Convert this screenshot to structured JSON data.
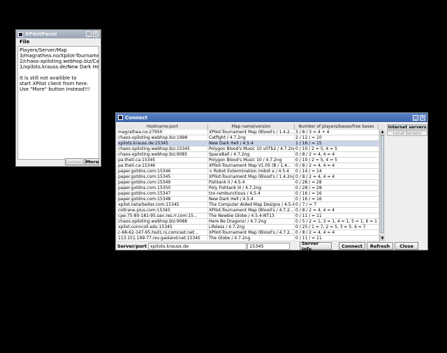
{
  "panel": {
    "title": "XPilotPanel",
    "menu_file": "File",
    "text": "Players/Server/Map\n3/magrathea.no/Xpilot-Tournament Map\n2/chaos-xpiloting.webhop.biz/Catfight\n1/xpilots.krauss.de/New Dark Hell\n\nIt is still not availible to\nstart XPilot client from here.\nUse \"More\" button instead!!!",
    "connect_label": "Connect",
    "more_label": "More"
  },
  "connect": {
    "title": "Connect",
    "headers": [
      "Hostname:port",
      "Map name/version",
      "Number of players/bases/free bases"
    ],
    "rows": [
      [
        "magrathea.no:27950",
        "XPilot-Tournament Map (Blood's / 1.4.2...",
        "3 / 8 / 3 = 4 + 4"
      ],
      [
        "chaos-xpiloting.webhop.biz:1998",
        "Catfight / 4.7.2ng",
        "2 / 12 / = 10"
      ],
      [
        "xpilots.krauss.de:15345",
        "New Dark Hell / 4.5.4",
        "1 / 16 / = 15"
      ],
      [
        "chaos-xpiloting.webhop.biz:15345",
        "Polygon Blood's Music 10 v0Tb2 / 4.7.2ng",
        "0 / 10 / 2 = 5, 4 = 5"
      ],
      [
        "chaos-xpiloting.webhop.biz:9085",
        "SpaceBall / 4.7.2ng",
        "0 / 8 / 2 = 4, 4 = 4"
      ],
      [
        "pa.theti.ca:15345",
        "Polygon Blood's Music 10 / 4.7.2ng",
        "0 / 10 / 2 = 5, 4 = 5"
      ],
      [
        "pa.theti.ca:15346",
        "XPilot-Tournament Map V1.05 (B / 1.4...",
        "0 / 8 / 2 = 4, 4 = 4"
      ],
      [
        "paper.gotdns.com:15346",
        "> Robot Extermination /robot a / 4.5.4",
        "0 / 14 / = 14"
      ],
      [
        "paper.gotdns.com:15345",
        "XPilot-Tournament Map (Blood's / 1.4.2ng)",
        "0 / 8 / 2 = 4, 4 = 4"
      ],
      [
        "paper.gotdns.com:15349",
        "Fishtank II / 4.5.4",
        "0 / 28 / = 28"
      ],
      [
        "paper.gotdns.com:15350",
        "Poly Fishtank III / 4.7.2ng",
        "0 / 28 / = 28"
      ],
      [
        "paper.gotdns.com:15347",
        "tzx-rambunctious / 4.5.4",
        "0 / 16 / = 16"
      ],
      [
        "paper.gotdns.com:15348",
        "New Dark Hell / 4.5.4",
        "0 / 16 / = 16"
      ],
      [
        "xpilot.netarbeiter.com:15345",
        "The Computer Aided Map Designs / 4.5.4",
        "0 / 7 / = 7"
      ],
      [
        "coltrane.plus.com:15345",
        "XPilot-Tournament Map (Blood's / 4.7.2...",
        "0 / 8 / 2 = 4, 4 = 4"
      ],
      [
        "cpe-75-80-181-95.san.res.rr.com:15...",
        "The Newbie Globe / 4.5.4-NT13",
        "0 / 11 / = 11"
      ],
      [
        "chaos-xpiloting.webhop.biz:9086",
        "Here Be Dragons! / 4.7.2ng",
        "0 / 5 / 2 = 1, 3 = 1, 4 = 1, 5 = 1, 6 = 1"
      ],
      [
        "xpilot.conncoll.edu:15345",
        "Lifeless / 4.7.2ng",
        "0 / 25 / 1 = 7, 2 = 5, 3 = 5, 4 = 7"
      ],
      [
        "c-68-62-147-95.hsd1.nj.comcast.net...",
        "XPilot-Tournament Map (Blood's / 4.7.2...",
        "0 / 8 / 2 = 4, 4 = 4"
      ],
      [
        "113.151.199-77.rev.gaoland.net:15345",
        "The Globe / 4.7.2ng",
        "0 / 11 / = 11"
      ]
    ],
    "tabs": [
      "Internet servers",
      "Local Servers"
    ],
    "server_port_label": "Server/port",
    "server_value": "xpilots.krauss.de",
    "port_value": "15345",
    "server_info_label": "Server info",
    "connect_label": "Connect",
    "refresh_label": "Refresh",
    "close_label": "Close"
  }
}
